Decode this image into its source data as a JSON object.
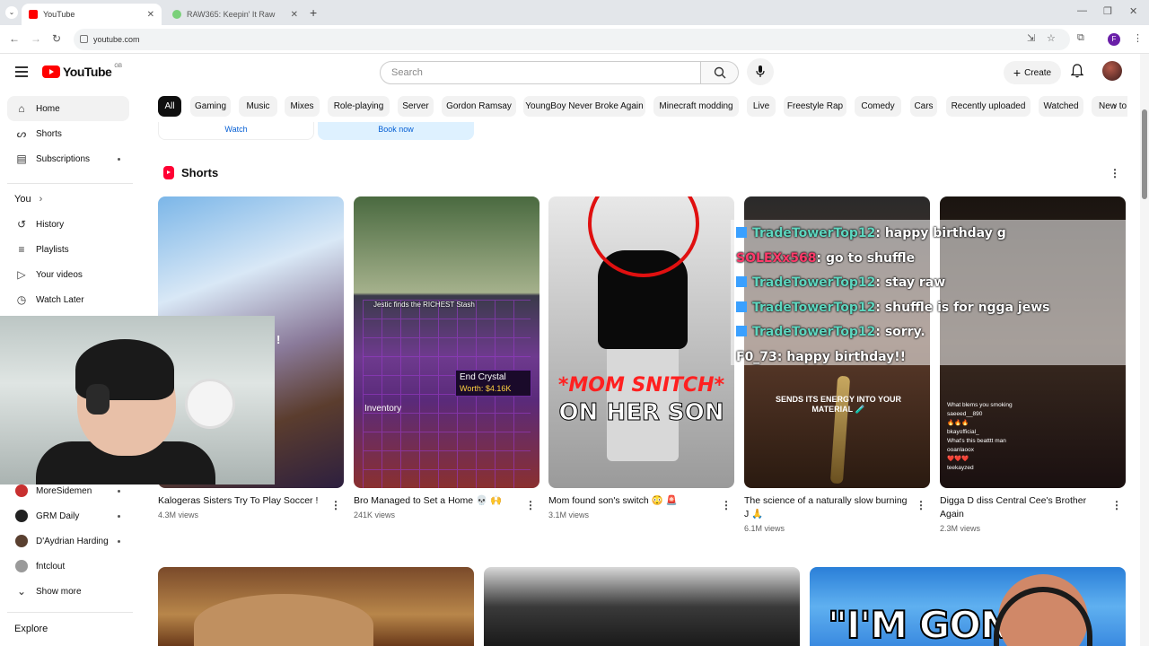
{
  "browser": {
    "tabs": [
      {
        "title": "YouTube",
        "active": true
      },
      {
        "title": "RAW365: Keepin' It Raw",
        "active": false
      }
    ],
    "url": "youtube.com",
    "profile_initial": "F"
  },
  "header": {
    "logo_text": "YouTube",
    "logo_country": "GB",
    "search_placeholder": "Search",
    "create_label": "Create"
  },
  "chips": [
    "All",
    "Gaming",
    "Music",
    "Mixes",
    "Role-playing",
    "Server",
    "Gordon Ramsay",
    "YoungBoy Never Broke Again",
    "Minecraft modding",
    "Live",
    "Freestyle Rap",
    "Comedy",
    "Cars",
    "Recently uploaded",
    "Watched",
    "New to you"
  ],
  "sidebar": {
    "main": [
      {
        "label": "Home",
        "icon": "home-icon",
        "selected": true
      },
      {
        "label": "Shorts",
        "icon": "shorts-icon"
      },
      {
        "label": "Subscriptions",
        "icon": "subscriptions-icon",
        "dot": true
      }
    ],
    "you_label": "You",
    "you_items": [
      {
        "label": "History",
        "icon": "history-icon"
      },
      {
        "label": "Playlists",
        "icon": "playlists-icon"
      },
      {
        "label": "Your videos",
        "icon": "your-videos-icon"
      },
      {
        "label": "Watch Later",
        "icon": "clock-icon"
      }
    ],
    "subs": [
      {
        "label": "MoreSidemen",
        "color": "#c83030"
      },
      {
        "label": "GRM Daily",
        "color": "#222222"
      },
      {
        "label": "D'Aydrian Harding",
        "color": "#5a4030"
      },
      {
        "label": "fntclout",
        "color": "#9a9a9a"
      }
    ],
    "show_more": "Show more",
    "explore": "Explore"
  },
  "ad": {
    "watch": "Watch",
    "book_now": "Book now"
  },
  "shorts_section": {
    "title": "Shorts",
    "items": [
      {
        "title": "Kalogeras Sisters Try To Play Soccer !",
        "views": "4.3M views",
        "overlay": "!"
      },
      {
        "title": "Bro Managed to Set a Home 💀 🙌",
        "views": "241K views",
        "overlay": "Jestic finds the RICHEST Stash",
        "item": "End Crystal",
        "worth": "Worth: $4.16K",
        "inventory": "Inventory"
      },
      {
        "title": "Mom found son's switch 😳 🚨",
        "views": "3.1M views",
        "overlay1": "*MOM SNITCH*",
        "overlay2": "ON HER SON"
      },
      {
        "title": "The science of a naturally slow burning J 🙏",
        "views": "6.1M views",
        "overlay": "SENDS ITS ENERGY INTO YOUR MATERIAL 🧪"
      },
      {
        "title": "Digga D diss Central Cee's Brother Again",
        "views": "2.3M views",
        "comments": [
          "What blems you smoking",
          "saeeed__890",
          "🔥🔥🔥",
          "bkayofficial_",
          "What's this beatttt man",
          "ooanlaoox",
          "❤️❤️❤️",
          "teekayzed"
        ]
      }
    ]
  },
  "chat_overlay": [
    {
      "user": "TradeTowerTop12",
      "msg": ": happy birthday g",
      "style": "badge"
    },
    {
      "user": "SOLEXx568",
      "msg": ": go to shuffle",
      "style": "red"
    },
    {
      "user": "TradeTowerTop12",
      "msg": ": stay raw",
      "style": "badge"
    },
    {
      "user": "TradeTowerTop12",
      "msg": ": shuffle is for ngga jews",
      "style": "badge"
    },
    {
      "user": "TradeTowerTop12",
      "msg": ": sorry.",
      "style": "badge"
    },
    {
      "user": "F0_73",
      "msg": ": happy birthday!!",
      "style": "white"
    }
  ],
  "row2": {
    "thumb3_text": "\"I'M GONNA"
  },
  "colors": {
    "accent_red": "#ff0000",
    "link_blue": "#065fd4",
    "chip_selected": "#0f0f0f"
  }
}
